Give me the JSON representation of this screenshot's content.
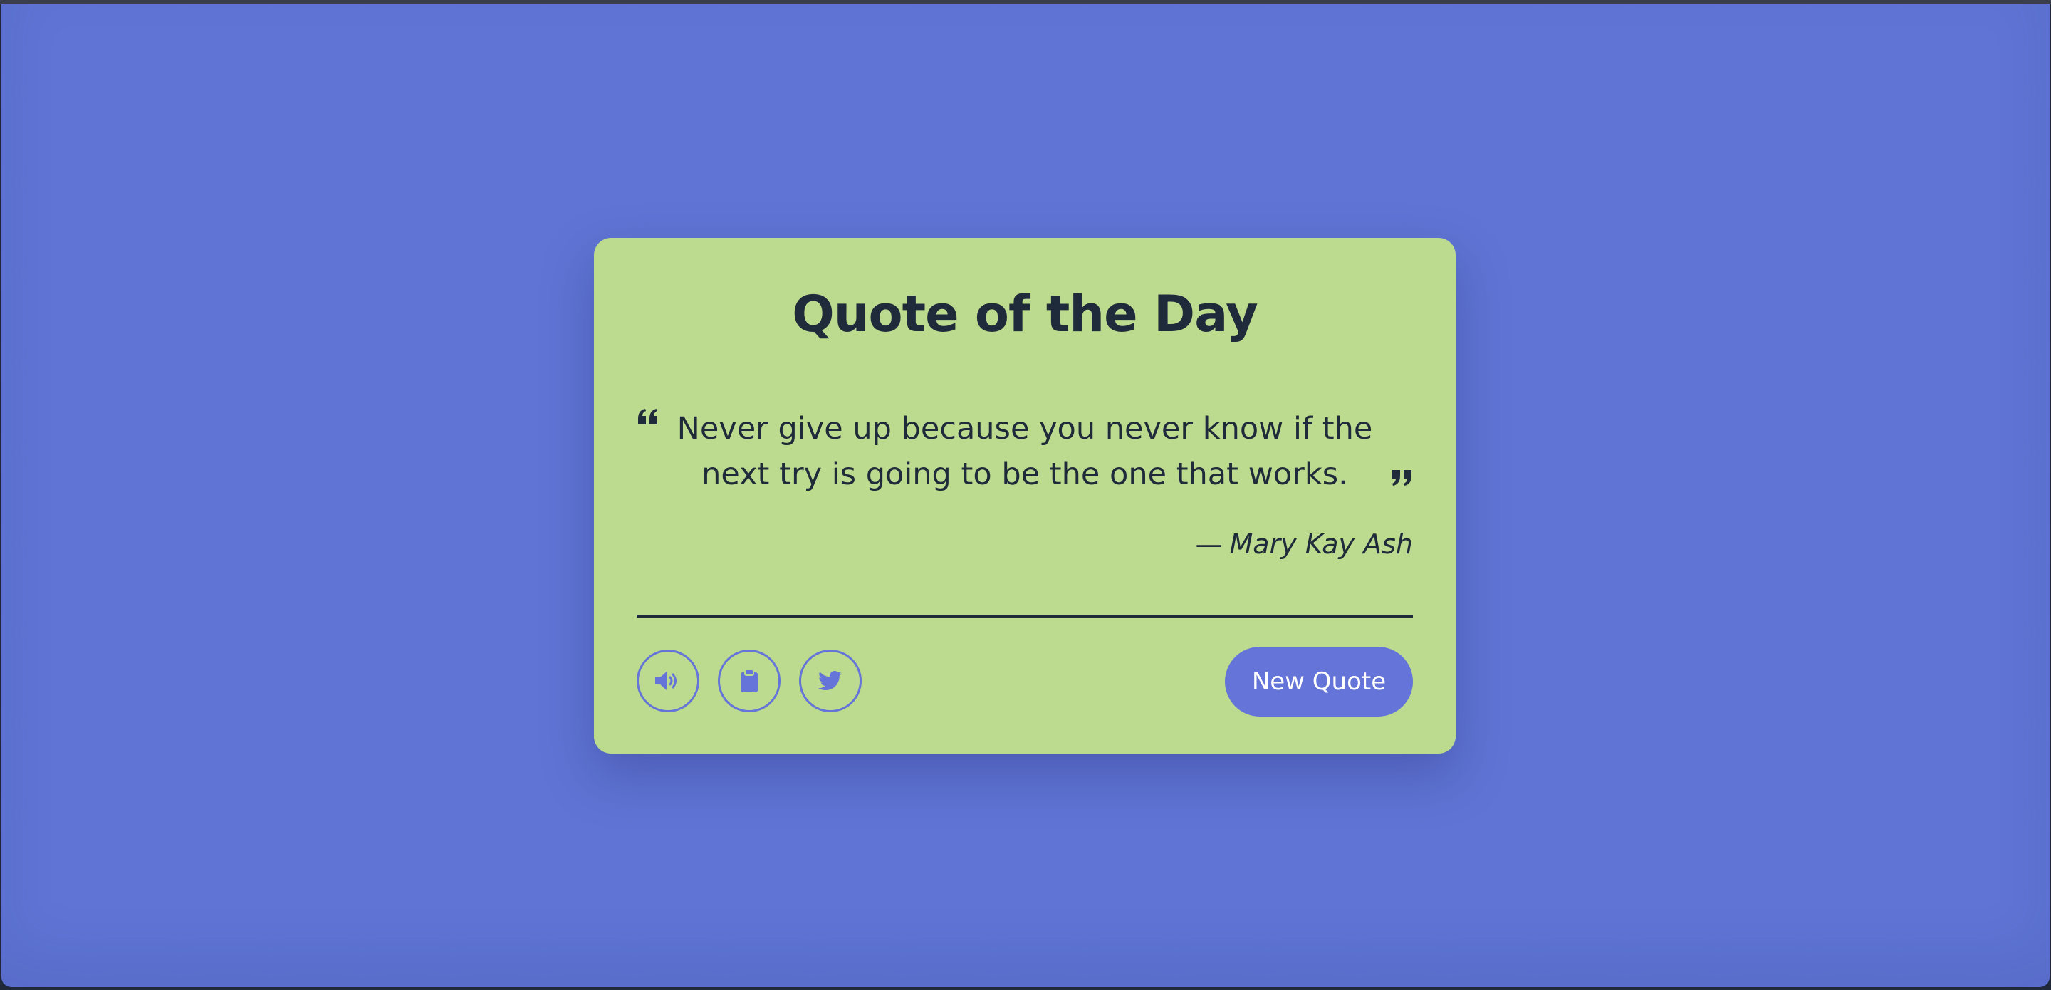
{
  "card": {
    "title": "Quote of the Day",
    "quote": "Never give up because you never know if the next try is going to be the one that works.",
    "author_dash": "—",
    "author": "Mary Kay Ash"
  },
  "actions": {
    "speech_icon": "volume-icon",
    "copy_icon": "clipboard-icon",
    "twitter_icon": "twitter-icon",
    "new_quote_label": "New Quote"
  },
  "colors": {
    "background": "#5f74d4",
    "card": "#bddb8f",
    "text": "#1f2a3a",
    "accent": "#6474d8"
  }
}
